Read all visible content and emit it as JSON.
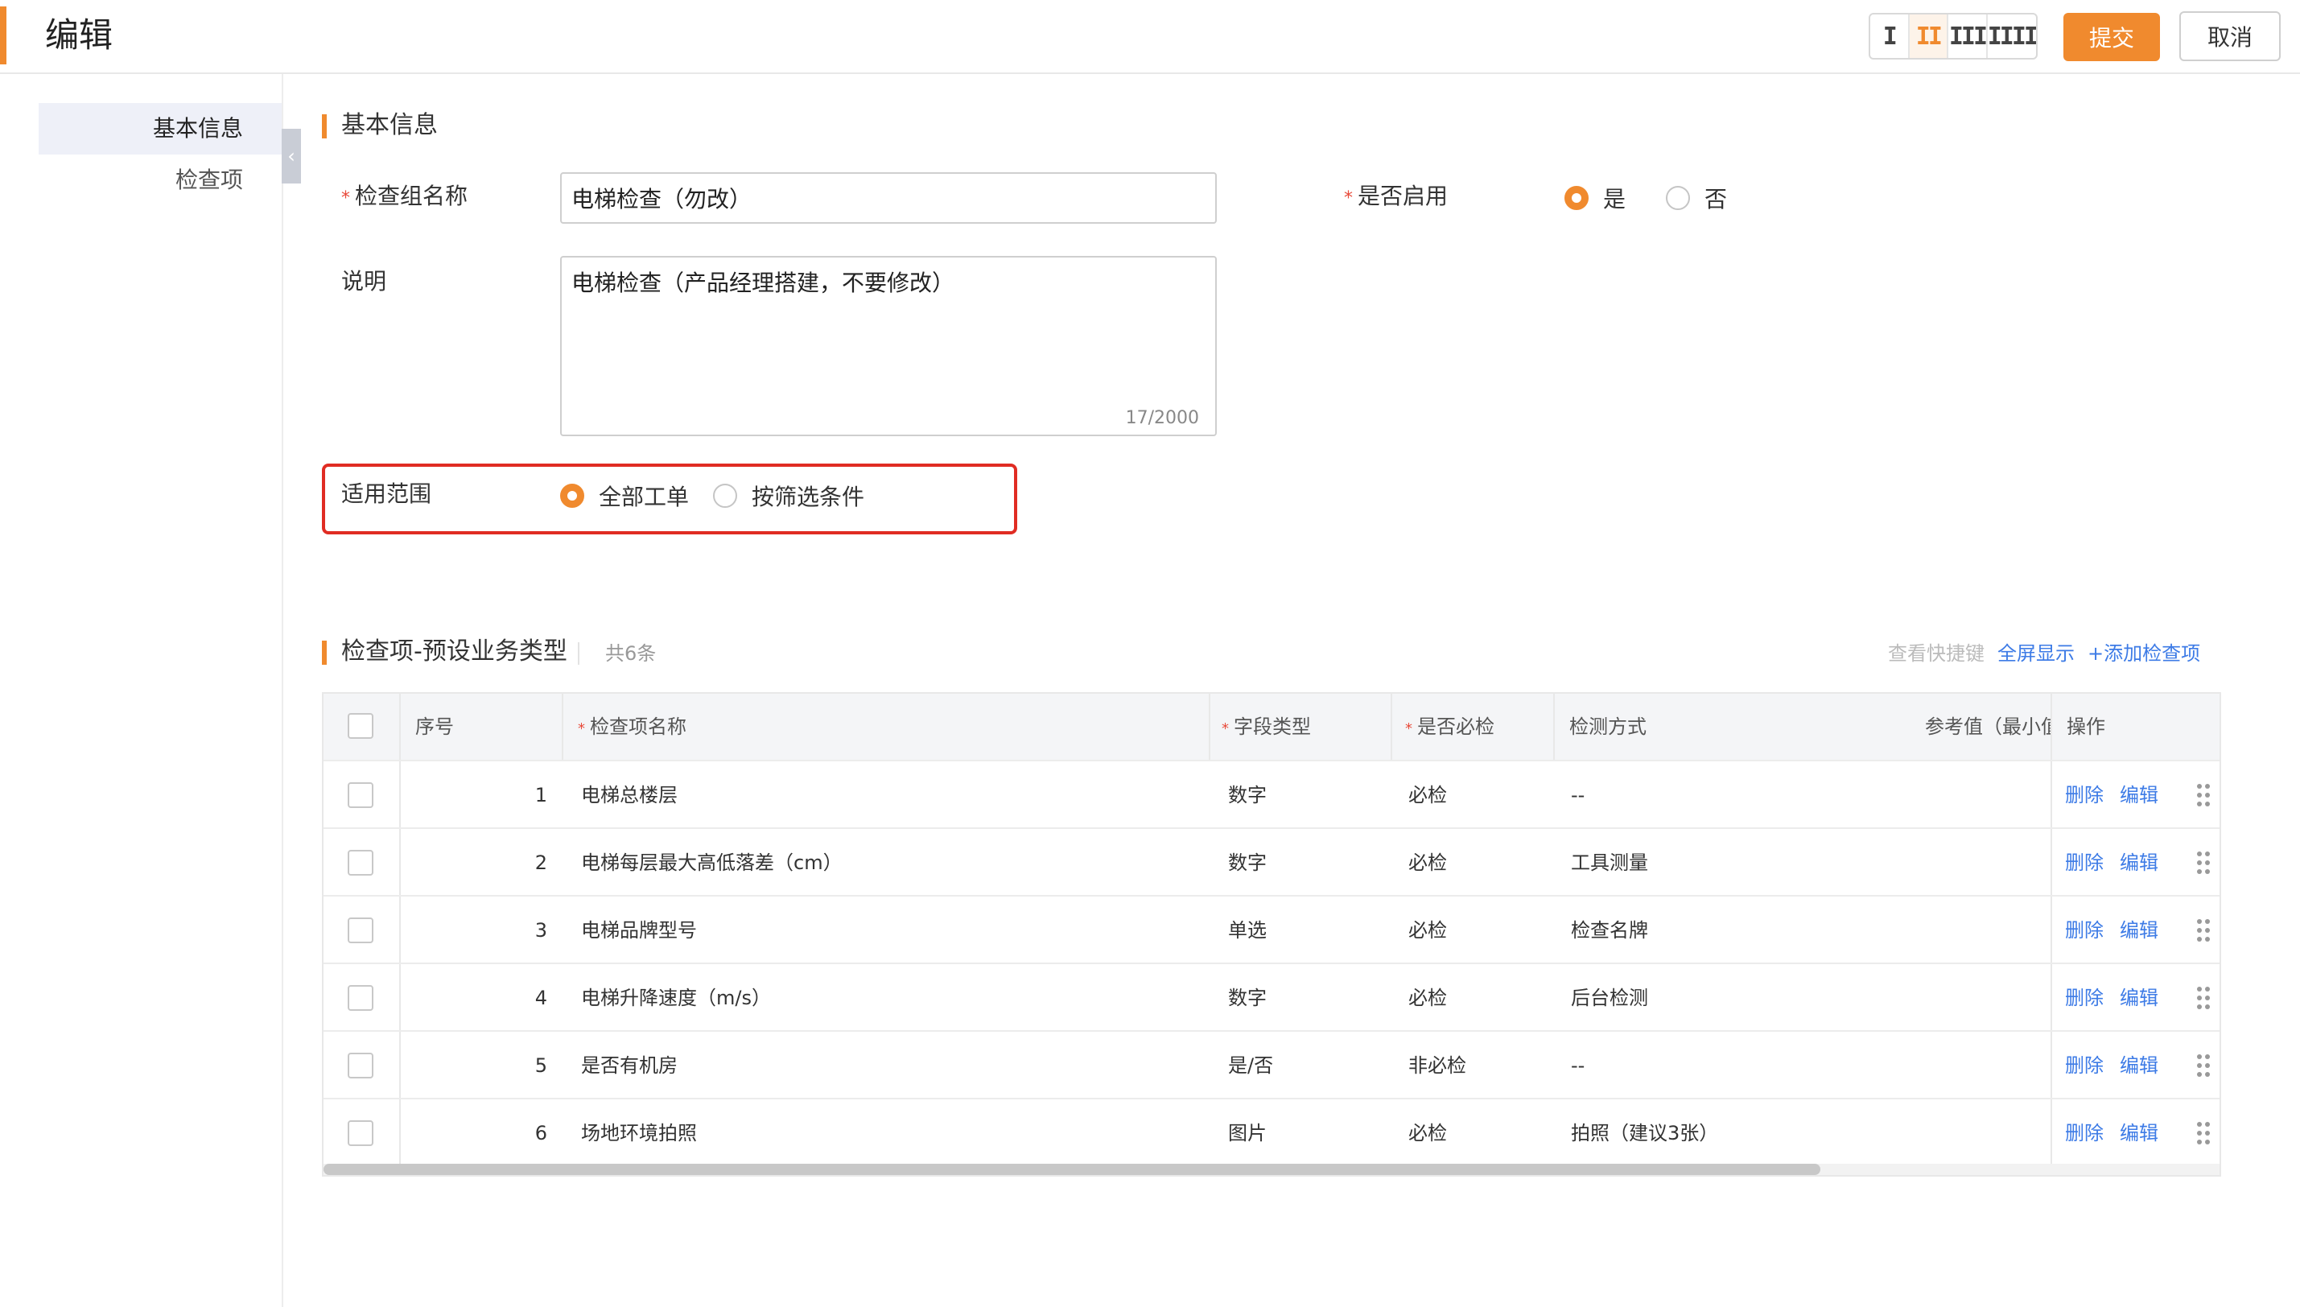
{
  "header": {
    "title": "编辑",
    "submit_label": "提交",
    "cancel_label": "取消",
    "column_switch": [
      "I",
      "II",
      "III",
      "IIII"
    ],
    "accent_color": "#f08a2e"
  },
  "sidebar": {
    "items": [
      {
        "label": "基本信息",
        "active": true
      },
      {
        "label": "检查项",
        "active": false
      }
    ]
  },
  "basic": {
    "section_title": "基本信息",
    "group_name_label": "检查组名称",
    "group_name_value": "电梯检查（勿改）",
    "enabled_label": "是否启用",
    "enabled_options": [
      "是",
      "否"
    ],
    "enabled_selected": "是",
    "desc_label": "说明",
    "desc_value": "电梯检查（产品经理搭建，不要修改）",
    "desc_counter": "17/2000",
    "scope_label": "适用范围",
    "scope_options": [
      "全部工单",
      "按筛选条件"
    ],
    "scope_selected": "全部工单"
  },
  "items": {
    "section_title": "检查项-预设业务类型",
    "count": "共6条",
    "shortcut_link": "查看快捷键",
    "fullscreen_link": "全屏显示",
    "add_link": "+添加检查项",
    "columns": [
      "序号",
      "检查项名称",
      "字段类型",
      "是否必检",
      "检测方式",
      "参考值（最小值",
      "操作"
    ],
    "delete_label": "删除",
    "edit_label": "编辑",
    "rows": [
      {
        "no": "1",
        "name": "电梯总楼层",
        "type": "数字",
        "required": "必检",
        "method": "--"
      },
      {
        "no": "2",
        "name": "电梯每层最大高低落差（cm）",
        "type": "数字",
        "required": "必检",
        "method": "工具测量"
      },
      {
        "no": "3",
        "name": "电梯品牌型号",
        "type": "单选",
        "required": "必检",
        "method": "检查名牌"
      },
      {
        "no": "4",
        "name": "电梯升降速度（m/s）",
        "type": "数字",
        "required": "必检",
        "method": "后台检测"
      },
      {
        "no": "5",
        "name": "是否有机房",
        "type": "是/否",
        "required": "非必检",
        "method": "--"
      },
      {
        "no": "6",
        "name": "场地环境拍照",
        "type": "图片",
        "required": "必检",
        "method": "拍照（建议3张）"
      }
    ]
  }
}
